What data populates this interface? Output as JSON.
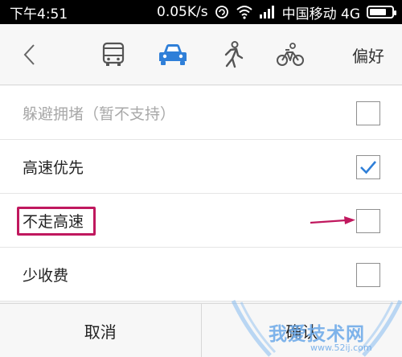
{
  "status_bar": {
    "time": "下午4:51",
    "network_speed": "0.05K/s",
    "carrier": "中国移动 4G",
    "battery_percent": 80
  },
  "toolbar": {
    "preferences_label": "偏好",
    "modes": [
      {
        "name": "bus-icon",
        "selected": false
      },
      {
        "name": "car-icon",
        "selected": true
      },
      {
        "name": "walk-icon",
        "selected": false
      },
      {
        "name": "bike-icon",
        "selected": false
      }
    ],
    "accent_color": "#2f7fd8"
  },
  "options": [
    {
      "label": "躲避拥堵（暂不支持）",
      "checked": false,
      "disabled": true
    },
    {
      "label": "高速优先",
      "checked": true,
      "disabled": false
    },
    {
      "label": "不走高速",
      "checked": false,
      "disabled": false
    },
    {
      "label": "少收费",
      "checked": false,
      "disabled": false
    }
  ],
  "annotation_color": "#c0185e",
  "bottom": {
    "cancel_label": "取消",
    "confirm_label": "确认"
  },
  "watermark": {
    "text": "我爱技术网",
    "url": "www.52ij.com"
  }
}
